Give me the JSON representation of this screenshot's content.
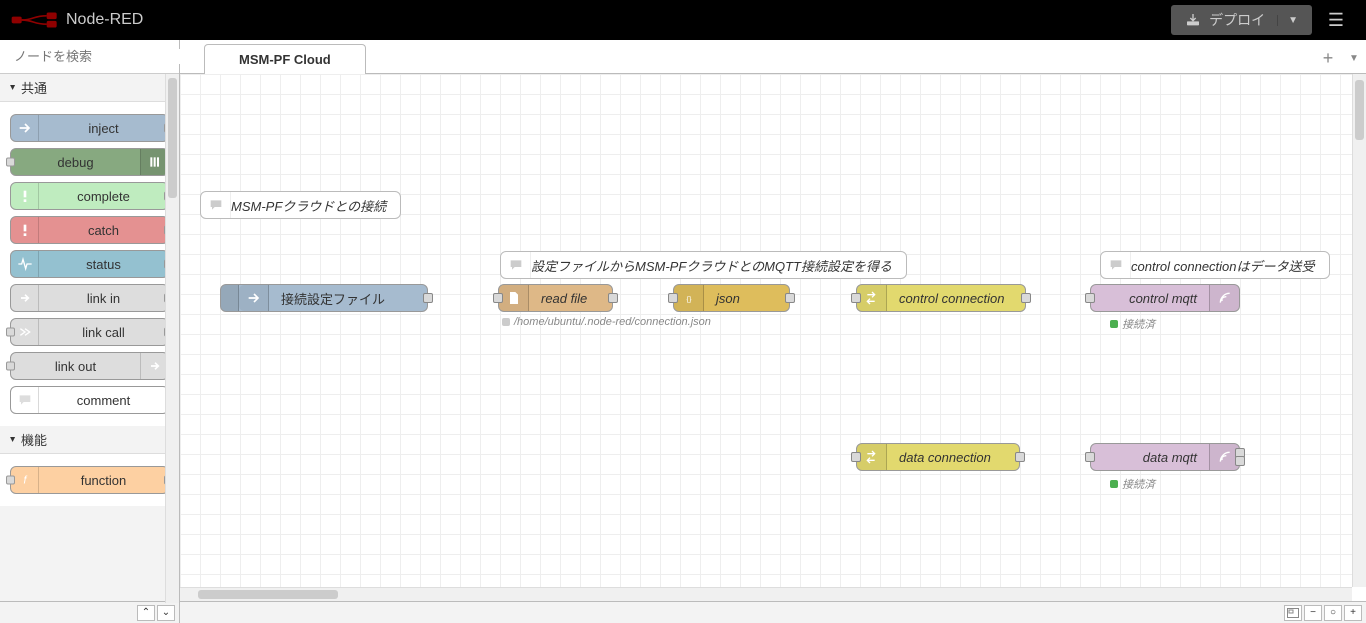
{
  "header": {
    "title": "Node-RED",
    "deploy_label": "デプロイ"
  },
  "palette": {
    "search_placeholder": "ノードを検索",
    "categories": {
      "common": {
        "label": "共通"
      },
      "function": {
        "label": "機能"
      }
    },
    "nodes": {
      "inject": "inject",
      "debug": "debug",
      "complete": "complete",
      "catch": "catch",
      "status": "status",
      "link_in": "link in",
      "link_call": "link call",
      "link_out": "link out",
      "comment": "comment",
      "function": "function"
    }
  },
  "workspace": {
    "tab_label": "MSM-PF Cloud"
  },
  "flow": {
    "comment1": "MSM-PFクラウドとの接続",
    "comment2": "設定ファイルからMSM-PFクラウドとのMQTT接続設定を得る",
    "comment3": "control connectionはデータ送受",
    "inject": {
      "label": "接続設定ファイル "
    },
    "readfile": {
      "label": "read file",
      "status": "/home/ubuntu/.node-red/connection.json"
    },
    "json": {
      "label": "json"
    },
    "control_conn": {
      "label": "control connection"
    },
    "data_conn": {
      "label": "data connection"
    },
    "control_mqtt": {
      "label": "control mqtt",
      "status": "接続済"
    },
    "data_mqtt": {
      "label": "data mqtt",
      "status": "接続済"
    }
  }
}
